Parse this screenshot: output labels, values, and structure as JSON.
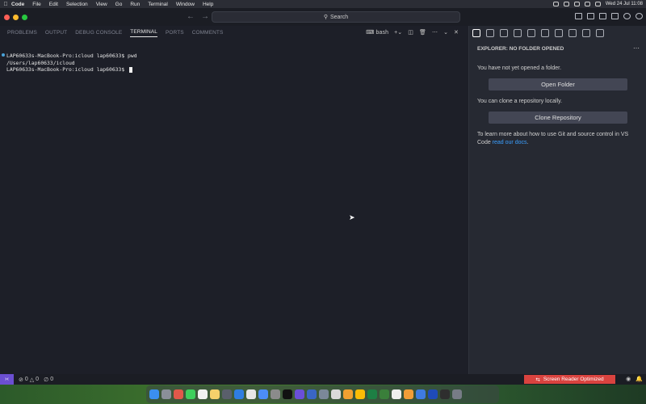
{
  "menubar": {
    "app_name": "Code",
    "items": [
      "File",
      "Edit",
      "Selection",
      "View",
      "Go",
      "Run",
      "Terminal",
      "Window",
      "Help"
    ],
    "clock": "Wed 24 Jul  11:08"
  },
  "titlebar": {
    "search_label": "Search"
  },
  "panel": {
    "tabs": [
      "PROBLEMS",
      "OUTPUT",
      "DEBUG CONSOLE",
      "TERMINAL",
      "PORTS",
      "COMMENTS"
    ],
    "active_tab": "TERMINAL",
    "shell_name": "bash"
  },
  "terminal": {
    "lines": [
      "LAP60633s-MacBook-Pro:icloud lap60633$ pwd",
      "/Users/lap60633/icloud",
      "LAP60633s-MacBook-Pro:icloud lap60633$ "
    ]
  },
  "sidebar": {
    "header": "EXPLORER: NO FOLDER OPENED",
    "no_folder_text": "You have not yet opened a folder.",
    "open_folder_label": "Open Folder",
    "clone_text": "You can clone a repository locally.",
    "clone_label": "Clone Repository",
    "learn_text_1": "To learn more about how to use Git and source control in VS Code ",
    "learn_link": "read our docs",
    "learn_text_2": "."
  },
  "statusbar": {
    "errors": "0",
    "warnings": "0",
    "ports": "0",
    "screen_reader": "Screen Reader Optimized"
  },
  "colors": {
    "accent_link": "#3b9fff",
    "remote_badge": "#6b4fd1",
    "screen_reader_badge": "#d9433f"
  }
}
